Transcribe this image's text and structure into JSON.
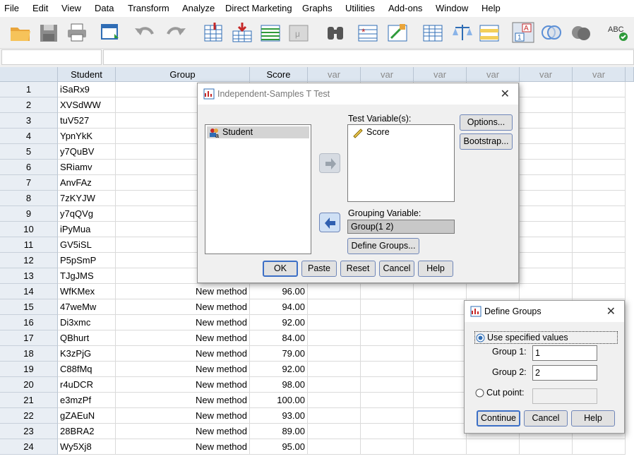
{
  "menu": [
    "File",
    "Edit",
    "View",
    "Data",
    "Transform",
    "Analyze",
    "Direct Marketing",
    "Graphs",
    "Utilities",
    "Add-ons",
    "Window",
    "Help"
  ],
  "toolbar": [
    "open-icon",
    "save-icon",
    "print-icon",
    "recall-dialog-icon",
    "undo-icon",
    "redo-icon",
    "goto-case-icon",
    "goto-variable-icon",
    "variables-icon",
    "run-descriptives-icon",
    "find-icon",
    "insert-cases-icon",
    "insert-variable-icon",
    "split-file-icon",
    "weight-cases-icon",
    "select-cases-icon",
    "value-labels-icon",
    "use-sets-icon",
    "show-all-variables-icon",
    "spell-check-icon"
  ],
  "grid": {
    "columns": [
      "Student",
      "Group",
      "Score",
      "var",
      "var",
      "var",
      "var",
      "var",
      "var"
    ],
    "rows": [
      {
        "n": "1",
        "student": "iSaRx9",
        "group": "",
        "score": ""
      },
      {
        "n": "2",
        "student": "XVSdWW",
        "group": "",
        "score": ""
      },
      {
        "n": "3",
        "student": "tuV527",
        "group": "",
        "score": ""
      },
      {
        "n": "4",
        "student": "YpnYkK",
        "group": "",
        "score": ""
      },
      {
        "n": "5",
        "student": "y7QuBV",
        "group": "",
        "score": ""
      },
      {
        "n": "6",
        "student": "SRiamv",
        "group": "",
        "score": ""
      },
      {
        "n": "7",
        "student": "AnvFAz",
        "group": "",
        "score": ""
      },
      {
        "n": "8",
        "student": "7zKYJW",
        "group": "",
        "score": ""
      },
      {
        "n": "9",
        "student": "y7qQVg",
        "group": "",
        "score": ""
      },
      {
        "n": "10",
        "student": "iPyMua",
        "group": "",
        "score": ""
      },
      {
        "n": "11",
        "student": "GV5iSL",
        "group": "",
        "score": ""
      },
      {
        "n": "12",
        "student": "P5pSmP",
        "group": "",
        "score": ""
      },
      {
        "n": "13",
        "student": "TJgJMS",
        "group": "",
        "score": ""
      },
      {
        "n": "14",
        "student": "WfKMex",
        "group": "New method",
        "score": "96.00"
      },
      {
        "n": "15",
        "student": "47weMw",
        "group": "New method",
        "score": "94.00"
      },
      {
        "n": "16",
        "student": "Di3xmc",
        "group": "New method",
        "score": "92.00"
      },
      {
        "n": "17",
        "student": "QBhurt",
        "group": "New method",
        "score": "84.00"
      },
      {
        "n": "18",
        "student": "K3zPjG",
        "group": "New method",
        "score": "79.00"
      },
      {
        "n": "19",
        "student": "C88fMq",
        "group": "New method",
        "score": "92.00"
      },
      {
        "n": "20",
        "student": "r4uDCR",
        "group": "New method",
        "score": "98.00"
      },
      {
        "n": "21",
        "student": "e3mzPf",
        "group": "New method",
        "score": "100.00"
      },
      {
        "n": "22",
        "student": "gZAEuN",
        "group": "New method",
        "score": "93.00"
      },
      {
        "n": "23",
        "student": "28BRA2",
        "group": "New method",
        "score": "89.00"
      },
      {
        "n": "24",
        "student": "Wy5Xj8",
        "group": "New method",
        "score": "95.00"
      }
    ]
  },
  "ttest": {
    "title": "Independent-Samples T Test",
    "source_var": "Student",
    "test_label": "Test Variable(s):",
    "test_var": "Score",
    "grouping_label": "Grouping Variable:",
    "grouping_value": "Group(1 2)",
    "define_groups": "Define Groups...",
    "options": "Options...",
    "bootstrap": "Bootstrap...",
    "ok": "OK",
    "paste": "Paste",
    "reset": "Reset",
    "cancel": "Cancel",
    "help": "Help"
  },
  "define_groups": {
    "title": "Define Groups",
    "use_specified": "Use specified values",
    "group1_label": "Group 1:",
    "group1_value": "1",
    "group2_label": "Group 2:",
    "group2_value": "2",
    "cut_point": "Cut point:",
    "continue": "Continue",
    "cancel": "Cancel",
    "help": "Help"
  }
}
